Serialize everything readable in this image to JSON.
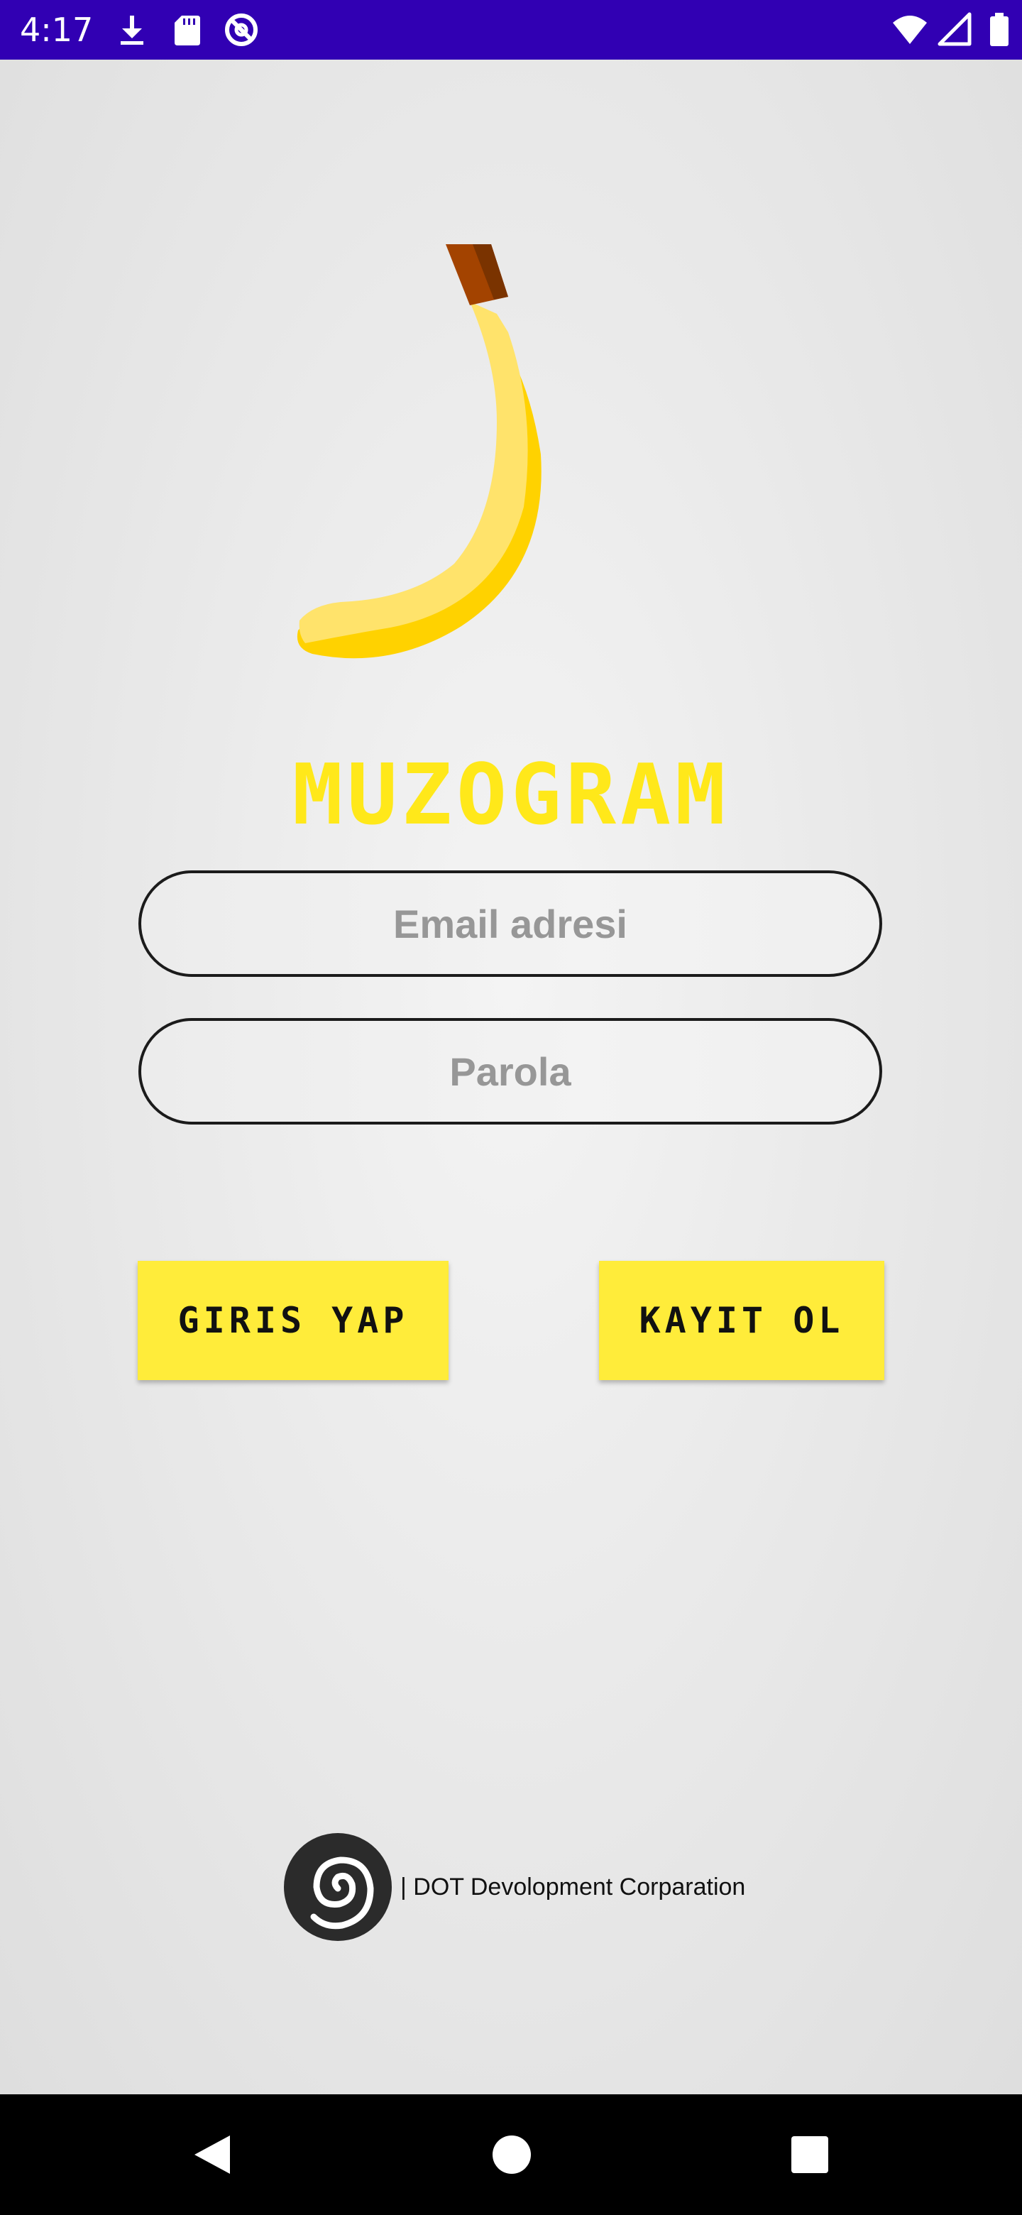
{
  "status_bar": {
    "time": "4:17",
    "background_color": "#3100b3",
    "left_icons": [
      "download-icon",
      "sd-card-icon",
      "data-saver-icon"
    ],
    "right_icons": [
      "wifi-icon",
      "cellular-signal-icon",
      "battery-icon"
    ]
  },
  "app": {
    "brand_name": "MUZOGRAM",
    "brand_color": "#ffe81a",
    "logo_icon": "banana-icon"
  },
  "login_form": {
    "email_placeholder": "Email adresi",
    "email_value": "",
    "password_placeholder": "Parola",
    "password_value": ""
  },
  "buttons": {
    "login_label": "GIRIS YAP",
    "register_label": "KAYIT OL",
    "color": "#ffec3a"
  },
  "footer": {
    "company_logo_icon": "spiral-logo-icon",
    "company_text": "| DOT Devolopment Corparation"
  },
  "navigation_bar": {
    "buttons": [
      "back-icon",
      "home-icon",
      "recents-icon"
    ]
  }
}
